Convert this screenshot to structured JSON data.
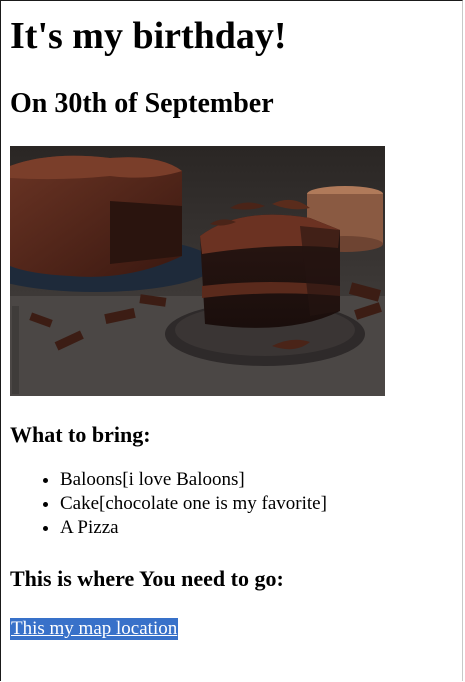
{
  "page": {
    "title": "It's my birthday!",
    "date_heading": "On 30th of September",
    "image_alt": "Chocolate birthday cake",
    "bring_heading": "What to bring:",
    "bring_items": [
      "Baloons[i love Baloons]",
      "Cake[chocolate one is my favorite]",
      "A Pizza"
    ],
    "location_heading": "This is where You need to go:",
    "map_link_label": "This my map location"
  },
  "colors": {
    "link_highlight": "#3871c9",
    "cake_brown": "#4a2418",
    "plate": "#2e2a2a",
    "backdrop": "#3a3736"
  }
}
